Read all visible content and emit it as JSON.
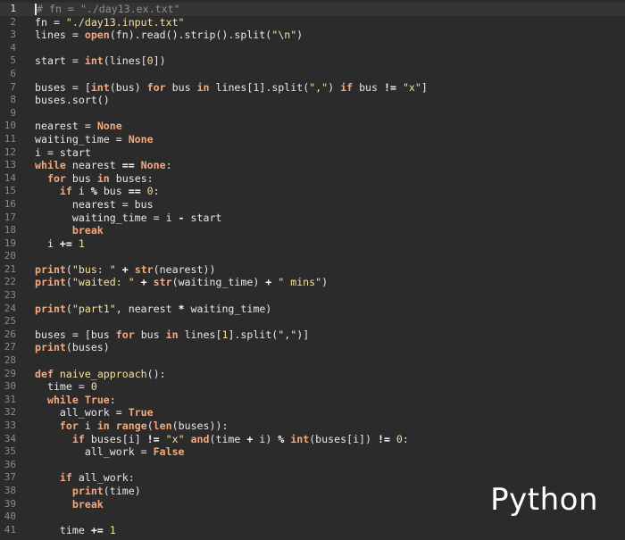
{
  "editor": {
    "language_label": "Python",
    "current_line": 1,
    "lines": [
      {
        "n": "1",
        "t": [
          [
            "cmt",
            "# fn = \"./day13.ex.txt\""
          ]
        ]
      },
      {
        "n": "2",
        "t": [
          [
            "",
            "fn = "
          ],
          [
            "str",
            "\"./day13.input.txt\""
          ]
        ]
      },
      {
        "n": "3",
        "t": [
          [
            "",
            "lines = "
          ],
          [
            "blt",
            "open"
          ],
          [
            "",
            "(fn).read().strip().split("
          ],
          [
            "str",
            "\"\\n\""
          ],
          [
            "",
            ")"
          ]
        ]
      },
      {
        "n": "4",
        "t": []
      },
      {
        "n": "5",
        "t": [
          [
            "",
            "start = "
          ],
          [
            "blt",
            "int"
          ],
          [
            "",
            "(lines["
          ],
          [
            "num",
            "0"
          ],
          [
            "",
            "])"
          ]
        ]
      },
      {
        "n": "6",
        "t": []
      },
      {
        "n": "7",
        "t": [
          [
            "",
            "buses = ["
          ],
          [
            "blt",
            "int"
          ],
          [
            "",
            "(bus) "
          ],
          [
            "kw",
            "for"
          ],
          [
            "",
            "bus "
          ],
          [
            "kw",
            "in"
          ],
          [
            "",
            "lines["
          ],
          [
            "num",
            "1"
          ],
          [
            "",
            "].split("
          ],
          [
            "str",
            "\",\""
          ],
          [
            "",
            ") "
          ],
          [
            "kw",
            "if"
          ],
          [
            "",
            "bus "
          ],
          [
            "op",
            "!="
          ],
          [
            "",
            ""
          ],
          [
            "str",
            " \"x\""
          ],
          [
            "",
            "]"
          ]
        ]
      },
      {
        "n": "8",
        "t": [
          [
            "",
            "buses.sort()"
          ]
        ]
      },
      {
        "n": "9",
        "t": []
      },
      {
        "n": "10",
        "t": [
          [
            "",
            "nearest = "
          ],
          [
            "kw",
            "None"
          ]
        ]
      },
      {
        "n": "11",
        "t": [
          [
            "",
            "waiting_time = "
          ],
          [
            "kw",
            "None"
          ]
        ]
      },
      {
        "n": "12",
        "t": [
          [
            "",
            "i = start"
          ]
        ]
      },
      {
        "n": "13",
        "t": [
          [
            "kw",
            "while"
          ],
          [
            "",
            "nearest "
          ],
          [
            "op",
            "=="
          ],
          [
            "",
            ""
          ],
          [
            "kw",
            " None"
          ],
          [
            "",
            ":"
          ]
        ]
      },
      {
        "n": "14",
        "t": [
          [
            "",
            "  "
          ],
          [
            "kw",
            "for"
          ],
          [
            "",
            "bus "
          ],
          [
            "kw",
            "in"
          ],
          [
            "",
            "buses:"
          ]
        ]
      },
      {
        "n": "15",
        "t": [
          [
            "",
            "    "
          ],
          [
            "kw",
            "if"
          ],
          [
            "",
            "i "
          ],
          [
            "op",
            "%"
          ],
          [
            "",
            "bus "
          ],
          [
            "op",
            "=="
          ],
          [
            "",
            ""
          ],
          [
            "num",
            " 0"
          ],
          [
            "",
            ":"
          ]
        ]
      },
      {
        "n": "16",
        "t": [
          [
            "",
            "      nearest = bus"
          ]
        ]
      },
      {
        "n": "17",
        "t": [
          [
            "",
            "      waiting_time = i "
          ],
          [
            "op",
            "-"
          ],
          [
            "",
            "start"
          ]
        ]
      },
      {
        "n": "18",
        "t": [
          [
            "",
            "      "
          ],
          [
            "kw",
            "break"
          ]
        ]
      },
      {
        "n": "19",
        "t": [
          [
            "",
            "  i "
          ],
          [
            "op",
            "+="
          ],
          [
            "",
            ""
          ],
          [
            "num",
            " 1"
          ]
        ]
      },
      {
        "n": "20",
        "t": []
      },
      {
        "n": "21",
        "t": [
          [
            "blt",
            "print"
          ],
          [
            "",
            "("
          ],
          [
            "str",
            "\"bus: \""
          ],
          [
            "",
            ""
          ],
          [
            "op",
            " +"
          ],
          [
            "",
            ""
          ],
          [
            "blt",
            " str"
          ],
          [
            "",
            "(nearest))"
          ]
        ]
      },
      {
        "n": "22",
        "t": [
          [
            "blt",
            "print"
          ],
          [
            "",
            "("
          ],
          [
            "str",
            "\"waited: \""
          ],
          [
            "",
            ""
          ],
          [
            "op",
            " +"
          ],
          [
            "",
            ""
          ],
          [
            "blt",
            " str"
          ],
          [
            "",
            "(waiting_time) "
          ],
          [
            "op",
            "+"
          ],
          [
            "",
            ""
          ],
          [
            "str",
            " \" mins\""
          ],
          [
            "",
            ")"
          ]
        ]
      },
      {
        "n": "23",
        "t": []
      },
      {
        "n": "24",
        "t": [
          [
            "blt",
            "print"
          ],
          [
            "",
            "("
          ],
          [
            "str",
            "\"part1\""
          ],
          [
            "",
            ", nearest "
          ],
          [
            "op",
            "*"
          ],
          [
            "",
            "waiting_time)"
          ]
        ]
      },
      {
        "n": "25",
        "t": []
      },
      {
        "n": "26",
        "t": [
          [
            "",
            "buses = [bus "
          ],
          [
            "kw",
            "for"
          ],
          [
            "",
            "bus "
          ],
          [
            "kw",
            "in"
          ],
          [
            "",
            "lines["
          ],
          [
            "num",
            "1"
          ],
          [
            "",
            "].split("
          ],
          [
            "str",
            "\",\""
          ],
          [
            "",
            ")]"
          ]
        ]
      },
      {
        "n": "27",
        "t": [
          [
            "blt",
            "print"
          ],
          [
            "",
            "(buses)"
          ]
        ]
      },
      {
        "n": "28",
        "t": []
      },
      {
        "n": "29",
        "t": [
          [
            "kw",
            "def"
          ],
          [
            "",
            ""
          ],
          [
            "fn",
            " naive_approach"
          ],
          [
            "",
            "():"
          ]
        ]
      },
      {
        "n": "30",
        "t": [
          [
            "",
            "  time = "
          ],
          [
            "num",
            "0"
          ]
        ]
      },
      {
        "n": "31",
        "t": [
          [
            "",
            "  "
          ],
          [
            "kw",
            "while"
          ],
          [
            "",
            ""
          ],
          [
            "kw",
            " True"
          ],
          [
            "",
            ":"
          ]
        ]
      },
      {
        "n": "32",
        "t": [
          [
            "",
            "    all_work = "
          ],
          [
            "kw",
            "True"
          ]
        ]
      },
      {
        "n": "33",
        "t": [
          [
            "",
            "    "
          ],
          [
            "kw",
            "for"
          ],
          [
            "",
            "i "
          ],
          [
            "kw",
            "in"
          ],
          [
            "",
            ""
          ],
          [
            "blt",
            " range"
          ],
          [
            "",
            "("
          ],
          [
            "blt",
            "len"
          ],
          [
            "",
            "(buses)):"
          ]
        ]
      },
      {
        "n": "34",
        "t": [
          [
            "",
            "      "
          ],
          [
            "kw",
            "if"
          ],
          [
            "",
            "buses[i] "
          ],
          [
            "op",
            "!="
          ],
          [
            "",
            ""
          ],
          [
            "str",
            " \"x\""
          ],
          [
            "",
            ""
          ],
          [
            "kw",
            " and"
          ],
          [
            "",
            "(time "
          ],
          [
            "op",
            "+"
          ],
          [
            "",
            "i) "
          ],
          [
            "op",
            "%"
          ],
          [
            "",
            ""
          ],
          [
            "blt",
            " int"
          ],
          [
            "",
            "(buses[i]) "
          ],
          [
            "op",
            "!="
          ],
          [
            "",
            ""
          ],
          [
            "num",
            " 0"
          ],
          [
            "",
            ":"
          ]
        ]
      },
      {
        "n": "35",
        "t": [
          [
            "",
            "        all_work = "
          ],
          [
            "kw",
            "False"
          ]
        ]
      },
      {
        "n": "36",
        "t": []
      },
      {
        "n": "37",
        "t": [
          [
            "",
            "    "
          ],
          [
            "kw",
            "if"
          ],
          [
            "",
            "all_work:"
          ]
        ]
      },
      {
        "n": "38",
        "t": [
          [
            "",
            "      "
          ],
          [
            "blt",
            "print"
          ],
          [
            "",
            "(time)"
          ]
        ]
      },
      {
        "n": "39",
        "t": [
          [
            "",
            "      "
          ],
          [
            "kw",
            "break"
          ]
        ]
      },
      {
        "n": "40",
        "t": []
      },
      {
        "n": "41",
        "t": [
          [
            "",
            "    time "
          ],
          [
            "op",
            "+="
          ],
          [
            "",
            ""
          ],
          [
            "num",
            " 1"
          ]
        ]
      }
    ]
  }
}
